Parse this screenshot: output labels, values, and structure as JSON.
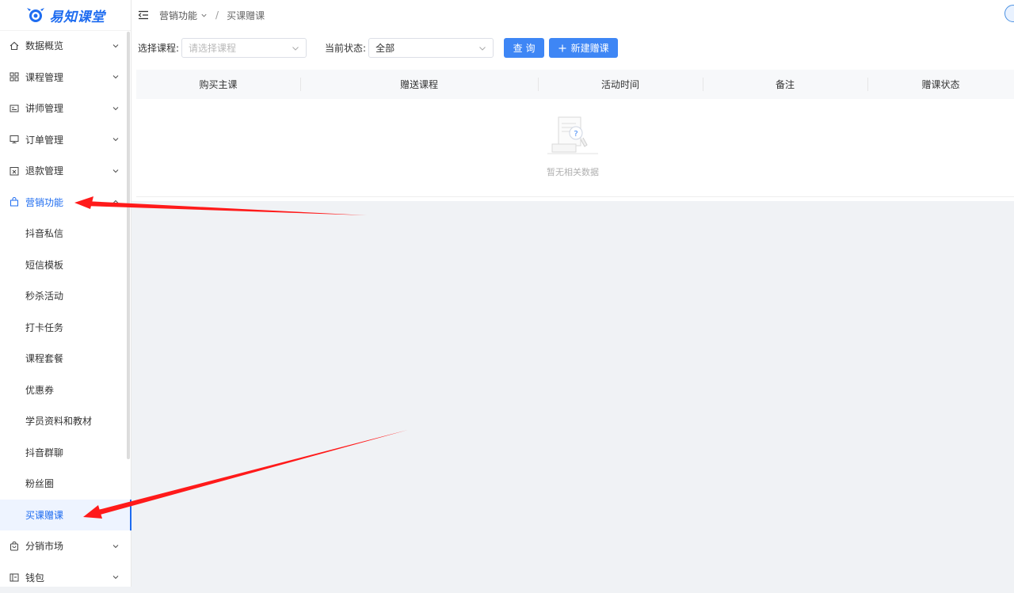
{
  "brand": {
    "name": "易知课堂"
  },
  "colors": {
    "accent": "#1e6cf0",
    "button": "#3e86f5",
    "arrow": "#ff1a1a"
  },
  "sidebar": {
    "items": [
      {
        "label": "数据概览",
        "icon": "home-icon",
        "expanded": false
      },
      {
        "label": "课程管理",
        "icon": "grid-icon",
        "expanded": false
      },
      {
        "label": "讲师管理",
        "icon": "id-card-icon",
        "expanded": false
      },
      {
        "label": "订单管理",
        "icon": "monitor-icon",
        "expanded": false
      },
      {
        "label": "退款管理",
        "icon": "calendar-x-icon",
        "expanded": false
      },
      {
        "label": "营销功能",
        "icon": "bag-icon",
        "expanded": true
      }
    ],
    "marketing_sub": [
      "抖音私信",
      "短信模板",
      "秒杀活动",
      "打卡任务",
      "课程套餐",
      "优惠券",
      "学员资料和教材",
      "抖音群聊",
      "粉丝圈",
      "买课赠课"
    ],
    "current_sub": "买课赠课",
    "bottom_items": [
      {
        "label": "分销市场",
        "icon": "store-icon"
      },
      {
        "label": "钱包",
        "icon": "wallet-icon"
      }
    ]
  },
  "header": {
    "breadcrumb_parent": "营销功能",
    "breadcrumb_separator": "/",
    "breadcrumb_current": "买课赠课"
  },
  "filters": {
    "course_label": "选择课程:",
    "course_placeholder": "请选择课程",
    "status_label": "当前状态:",
    "status_value": "全部",
    "query_button": "查 询",
    "new_button": "新建赠课"
  },
  "table": {
    "columns": [
      "购买主课",
      "赠送课程",
      "活动时间",
      "备注",
      "赠课状态"
    ],
    "rows": [],
    "empty_text": "暂无相关数据"
  }
}
